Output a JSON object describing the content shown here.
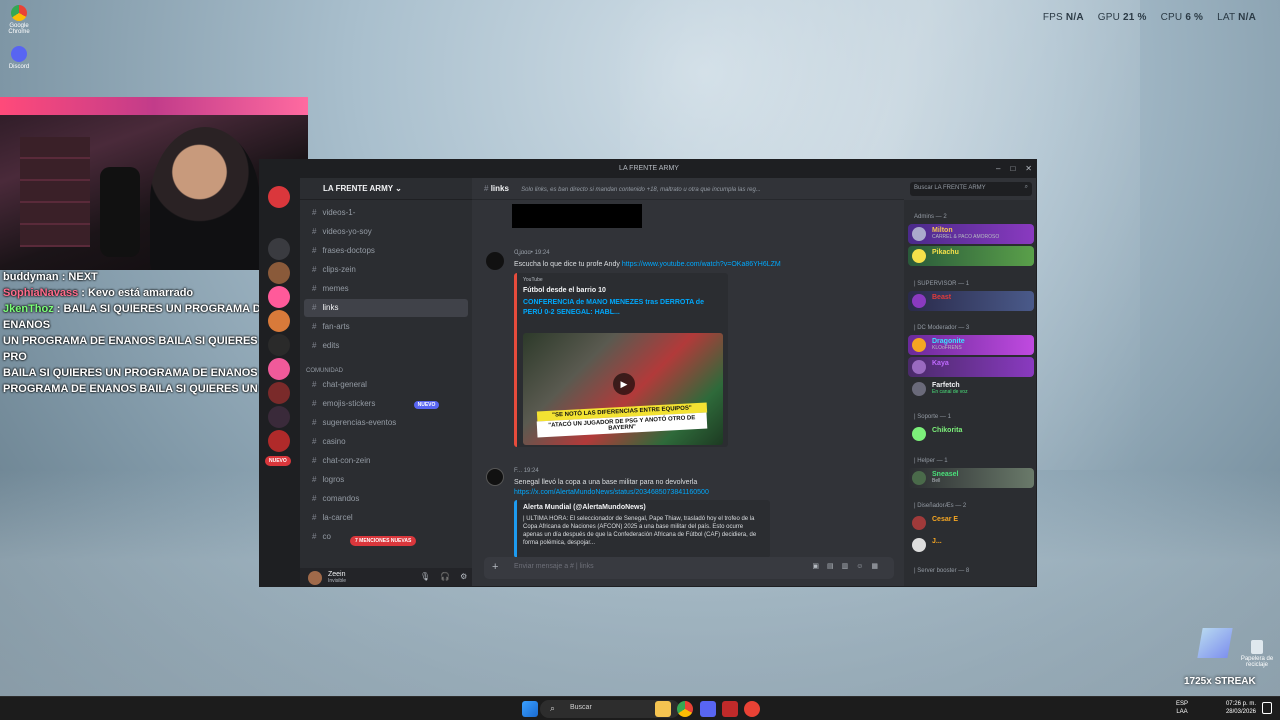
{
  "desktop": {
    "icons": [
      {
        "label": "Google Chrome",
        "icon": "chrome-icon",
        "color": "#e94235"
      },
      {
        "label": "Discord",
        "icon": "discord-icon",
        "color": "#5865f2"
      }
    ],
    "recycle_bin": "Papelera de reciclaje",
    "streak": "1725x STREAK"
  },
  "perf": {
    "fps_label": "FPS",
    "fps_value": "N/A",
    "gpu_label": "GPU",
    "gpu_value": "21 %",
    "cpu_label": "CPU",
    "cpu_value": "6 %",
    "lat_label": "LAT",
    "lat_value": "N/A"
  },
  "stream_chat": [
    {
      "user": "buddyman",
      "text": ": NEXT"
    },
    {
      "user": "SophiaNavass",
      "text": ": Kevo está amarrado"
    },
    {
      "user": "JkenThoz",
      "text": ": BAILA SI QUIERES UN PROGRAMA DE ENANOS"
    },
    {
      "user": "",
      "text": "UN PROGRAMA DE ENANOS   BAILA SI QUIERES UN PRO"
    },
    {
      "user": "",
      "text": "BAILA SI QUIERES UN PROGRAMA DE ENANOS   BA"
    },
    {
      "user": "",
      "text": "PROGRAMA DE ENANOS   BAILA SI QUIERES UN PROGR"
    }
  ],
  "discord": {
    "window_title": "LA FRENTE ARMY",
    "server_name": "LA FRENTE ARMY",
    "channels_top": [
      {
        "name": "videos-1-",
        "active": false
      },
      {
        "name": "videos-yo-soy",
        "active": false
      },
      {
        "name": "frases-doctops",
        "active": false
      },
      {
        "name": "clips-zein",
        "active": false
      },
      {
        "name": "memes",
        "active": false
      },
      {
        "name": "links",
        "active": true
      },
      {
        "name": "fan-arts",
        "active": false
      },
      {
        "name": "edits",
        "active": false
      }
    ],
    "category": "COMUNIDAD",
    "channels_community": [
      {
        "name": "chat-general",
        "badge": ""
      },
      {
        "name": "emojis-stickers",
        "badge": "NUEVO"
      },
      {
        "name": "sugerencias-eventos",
        "badge": ""
      },
      {
        "name": "casino",
        "badge": ""
      },
      {
        "name": "chat-con-zein",
        "badge": ""
      },
      {
        "name": "logros",
        "badge": ""
      },
      {
        "name": "comandos",
        "badge": ""
      },
      {
        "name": "la-carcel",
        "badge": ""
      },
      {
        "name": "co",
        "badge": ""
      }
    ],
    "new_pill": "NUEVO",
    "mentions_pill": "7 MENCIONES NUEVAS",
    "user": {
      "name": "Zeein",
      "status": "Invisible"
    },
    "channel_header": {
      "name": "links",
      "topic": "Solo links, es ban directo si mandan contenido +18, maltrato u otra que incumpla las reg..."
    },
    "search_placeholder": "Buscar LA FRENTE ARMY",
    "messages": [
      {
        "author": "Ɑʝɑɑɑ•",
        "time": "19:24",
        "text": "Escucha lo que dice tu profe Andy",
        "link": "https://www.youtube.com/watch?v=OKa86YH6LZM",
        "embed": {
          "provider": "YouTube",
          "name": "Fútbol desde el barrio 10",
          "title": "CONFERENCIA de MANO MENEZES tras DERROTA de PERÚ 0-2 SENEGAL: HABL...",
          "thumb_caption_1": "\"SE NOTÓ LAS DIFERENCIAS ENTRE EQUIPOS\"",
          "thumb_caption_2": "\"ATACÓ UN JUGADOR DE PSG Y ANOTÓ OTRO DE BAYERN\""
        }
      },
      {
        "author": "F...",
        "time": "19:24",
        "text": "Senegal llevó la copa a una base militar para no devolverla",
        "link": "https://x.com/AlertaMundoNews/status/2034685073841160500",
        "embed": {
          "name": "Alerta Mundial (@AlertaMundoNews)",
          "desc": "| ÚLTIMA HORA: El seleccionador de Senegal, Pape Thiaw, trasladó hoy el trofeo de la Copa Africana de Naciones (AFCON) 2025 a una base militar del país. Esto ocurre apenas un día después de que la Confederación Africana de Fútbol (CAF) decidiera, de forma polémica, despojar..."
        }
      }
    ],
    "input_placeholder": "Enviar mensaje a # | links",
    "member_groups": [
      {
        "title": "Admins — 2",
        "members": [
          {
            "name": "Milton",
            "sub": "CARREL & PACO AMOROSO",
            "color": "#f5c451",
            "bg": "#6a3fb0"
          },
          {
            "name": "Pikachu",
            "sub": "",
            "color": "#f5e04a",
            "bg": "#3a7a3a"
          }
        ]
      },
      {
        "title": "| SUPERVISOR — 1",
        "members": [
          {
            "name": "Beast",
            "sub": "",
            "color": "#e23b3b",
            "bg": "#2a3b6a"
          }
        ]
      },
      {
        "title": "| DC Moderador — 3",
        "members": [
          {
            "name": "Dragonite",
            "sub": "KLOoFRENS",
            "color": "#3ae0ff",
            "bg": "#8a3ac0"
          },
          {
            "name": "Kaya",
            "sub": "",
            "color": "#c06aff",
            "bg": "#6a2a8a"
          },
          {
            "name": "Farfetch",
            "sub": "En canal de voz",
            "color": "#f2f3f5",
            "bg": ""
          }
        ]
      },
      {
        "title": "| Soporte — 1",
        "members": [
          {
            "name": "Chikorita",
            "sub": "",
            "color": "#7cf07a",
            "bg": ""
          }
        ]
      },
      {
        "title": "| Helper — 1",
        "members": [
          {
            "name": "Sneasel",
            "sub": "Bell",
            "color": "#4ae07a",
            "bg": "#3a4a3a"
          }
        ]
      },
      {
        "title": "| DiseñadorÆs — 2",
        "members": [
          {
            "name": "Cesar E",
            "sub": "",
            "color": "#f5a623",
            "bg": ""
          },
          {
            "name": "J...",
            "sub": "",
            "color": "#f5a623",
            "bg": ""
          }
        ]
      },
      {
        "title": "| Server booster — 8",
        "members": []
      }
    ]
  },
  "taskbar": {
    "search_placeholder": "Buscar",
    "lang_top": "ESP",
    "lang_bottom": "LAA",
    "time": "07:26 p. m.",
    "date": "28/03/2026"
  }
}
